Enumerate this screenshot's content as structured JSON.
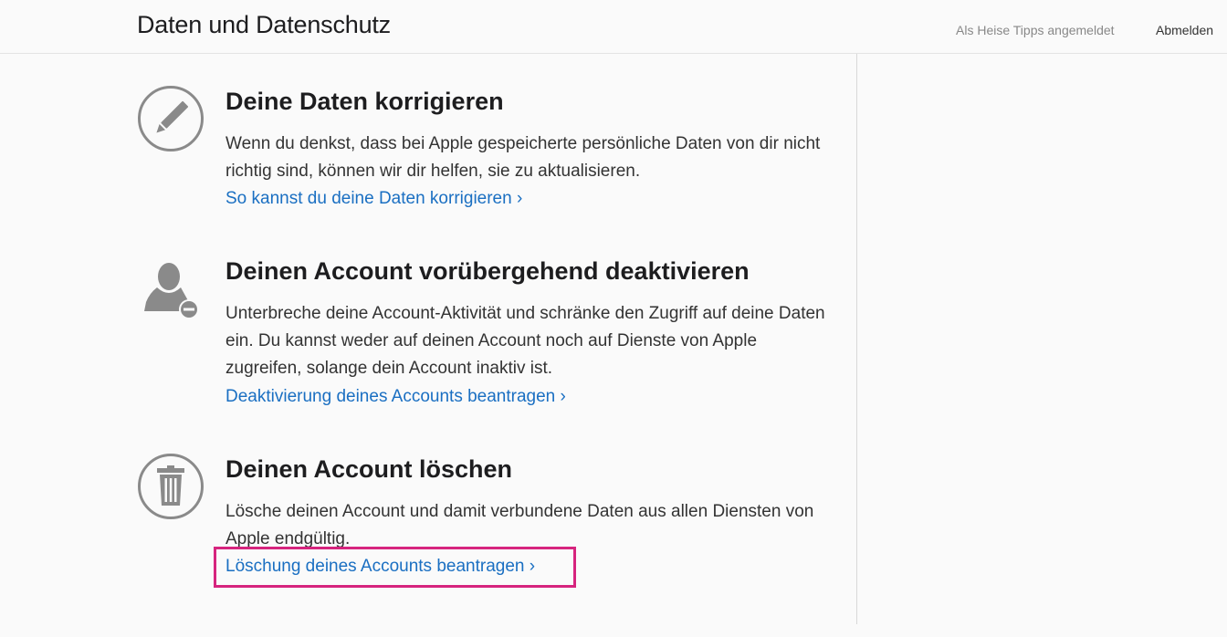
{
  "header": {
    "title": "Daten und Datenschutz",
    "signed_in_text": "Als Heise Tipps angemeldet",
    "signout_label": "Abmelden"
  },
  "sections": [
    {
      "icon": "pencil-icon",
      "heading": "Deine Daten korrigieren",
      "body": "Wenn du denkst, dass bei Apple gespeicherte persönliche Daten von dir nicht richtig sind, können wir dir helfen, sie zu aktualisieren.",
      "link": "So kannst du deine Daten korrigieren ›"
    },
    {
      "icon": "person-minus-icon",
      "heading": "Deinen Account vorübergehend deaktivieren",
      "body": "Unterbreche deine Account-Aktivität und schränke den Zugriff auf deine Daten ein. Du kannst weder auf deinen Account noch auf Dienste von Apple zugreifen, solange dein Account inaktiv ist.",
      "link": "Deaktivierung deines Accounts beantragen ›"
    },
    {
      "icon": "trash-icon",
      "heading": "Deinen Account löschen",
      "body": "Lösche deinen Account und damit verbundene Daten aus allen Diensten von Apple endgültig.",
      "link": "Löschung deines Accounts beantragen ›"
    }
  ],
  "colors": {
    "link": "#1a6fc2",
    "highlight": "#d6247e",
    "icon": "#8a8a8a"
  }
}
